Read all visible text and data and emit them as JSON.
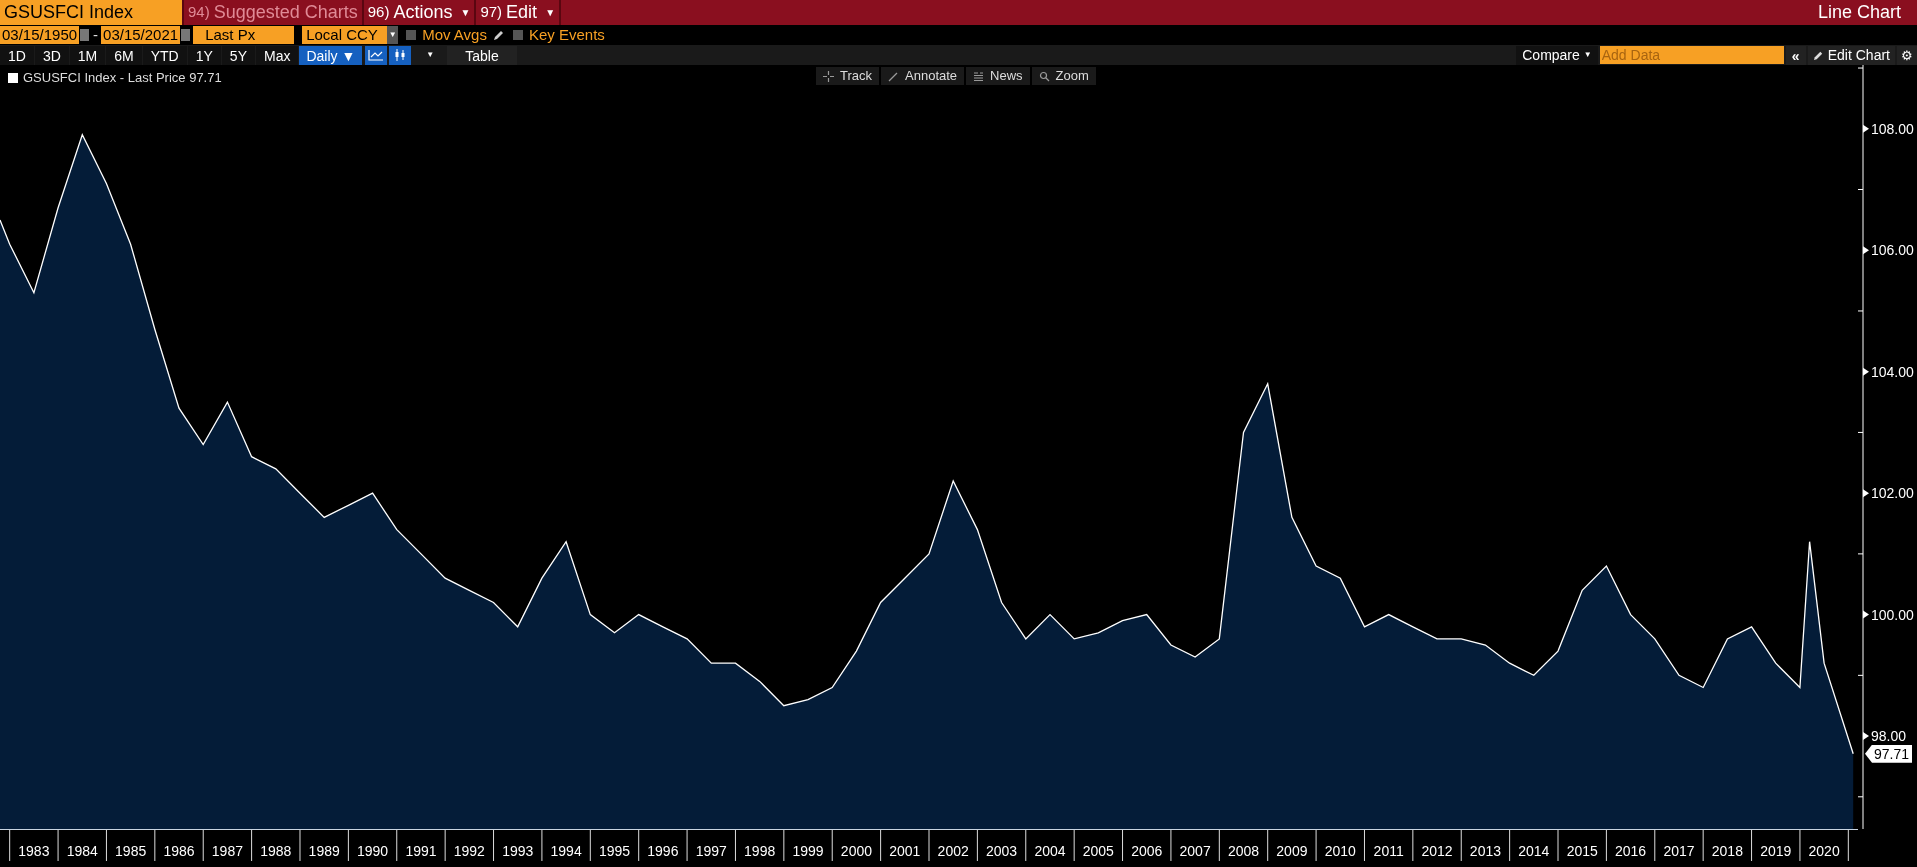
{
  "header": {
    "ticker": "GSUSFCI Index",
    "menus": [
      {
        "number": "94)",
        "label": "Suggested Charts",
        "disabled": true
      },
      {
        "number": "96)",
        "label": "Actions",
        "disabled": false,
        "caret": "▼"
      },
      {
        "number": "97)",
        "label": "Edit",
        "disabled": false,
        "caret": "▼"
      }
    ],
    "title": "Line Chart"
  },
  "settings": {
    "date_from": "03/15/1950",
    "separator": "-",
    "date_to": "03/15/2021",
    "field": "Last Px",
    "currency": "Local CCY",
    "currency_arrow": "▼",
    "checkboxes": [
      {
        "label": "Mov Avgs",
        "checked": false,
        "kind": "edit"
      },
      {
        "label": "Key Events",
        "checked": false,
        "kind": "plain"
      }
    ]
  },
  "toolbar": {
    "periods": [
      {
        "label": "1D",
        "selected": false
      },
      {
        "label": "3D",
        "selected": false
      },
      {
        "label": "1M",
        "selected": false
      },
      {
        "label": "6M",
        "selected": false
      },
      {
        "label": "YTD",
        "selected": false
      },
      {
        "label": "1Y",
        "selected": false
      },
      {
        "label": "5Y",
        "selected": false
      },
      {
        "label": "Max",
        "selected": false
      }
    ],
    "frequency": "Daily ▼",
    "chart_types": [
      {
        "kind": "line",
        "selected": true
      },
      {
        "kind": "candle",
        "selected": true
      }
    ],
    "chart_type_caret": "▼",
    "table_button": "Table",
    "compare": "Compare",
    "compare_caret": "▼",
    "collapse": "«",
    "settings": "⚙",
    "add_data_placeholder": "Add Data",
    "edit_chart": "Edit Chart"
  },
  "chart_tools": [
    {
      "kind": "track",
      "label": "Track"
    },
    {
      "kind": "annotate",
      "label": "Annotate"
    },
    {
      "kind": "news",
      "label": "News"
    },
    {
      "kind": "zoom",
      "label": "Zoom"
    }
  ],
  "legend_suffix": "- Last Price 97.71",
  "last_price_label": "97.71",
  "chart_data": {
    "type": "area",
    "x": [
      1982.3,
      1982.5,
      1983,
      1983.5,
      1984,
      1984.5,
      1985,
      1985.5,
      1986,
      1986.5,
      1987,
      1987.5,
      1988,
      1988.5,
      1989,
      1989.5,
      1990,
      1990.5,
      1991,
      1991.5,
      1992,
      1992.5,
      1993,
      1993.5,
      1994,
      1994.5,
      1995,
      1995.5,
      1996,
      1996.5,
      1997,
      1997.5,
      1998,
      1998.5,
      1999,
      1999.5,
      2000,
      2000.5,
      2001,
      2001.5,
      2002,
      2002.5,
      2003,
      2003.5,
      2004,
      2004.5,
      2005,
      2005.5,
      2006,
      2006.5,
      2007,
      2007.5,
      2008,
      2008.5,
      2009,
      2009.5,
      2010,
      2010.5,
      2011,
      2011.5,
      2012,
      2012.5,
      2013,
      2013.5,
      2014,
      2014.5,
      2015,
      2015.5,
      2016,
      2016.5,
      2017,
      2017.5,
      2018,
      2018.5,
      2019,
      2019.5,
      2019.7,
      2020,
      2020.6
    ],
    "series": [
      {
        "name": "GSUSFCI Index",
        "color": "#ffffff",
        "values": [
          106.5,
          106.1,
          105.3,
          106.7,
          107.9,
          107.1,
          106.1,
          104.7,
          103.4,
          102.8,
          103.5,
          102.6,
          102.4,
          102.0,
          101.6,
          101.8,
          102.0,
          101.4,
          101.0,
          100.6,
          100.4,
          100.2,
          99.8,
          100.6,
          101.2,
          100.0,
          99.7,
          100.0,
          99.8,
          99.6,
          99.2,
          99.2,
          98.9,
          98.5,
          98.6,
          98.8,
          99.4,
          100.2,
          100.6,
          101.0,
          102.2,
          101.4,
          100.2,
          99.6,
          100.0,
          99.6,
          99.7,
          99.9,
          100.0,
          99.5,
          99.3,
          99.6,
          103.0,
          103.8,
          101.6,
          100.8,
          100.6,
          99.8,
          100.0,
          99.8,
          99.6,
          99.6,
          99.5,
          99.2,
          99.0,
          99.4,
          100.4,
          100.8,
          100.0,
          99.6,
          99.0,
          98.8,
          99.6,
          99.8,
          99.2,
          98.8,
          101.2,
          99.2,
          97.71
        ]
      }
    ],
    "xlim": [
      1982.3,
      2020.7
    ],
    "ylim": [
      96.47,
      109.05
    ],
    "xticks": [
      1983,
      1984,
      1985,
      1986,
      1987,
      1988,
      1989,
      1990,
      1991,
      1992,
      1993,
      1994,
      1995,
      1996,
      1997,
      1998,
      1999,
      2000,
      2001,
      2002,
      2003,
      2004,
      2005,
      2006,
      2007,
      2008,
      2009,
      2010,
      2011,
      2012,
      2013,
      2014,
      2015,
      2016,
      2017,
      2018,
      2019,
      2020
    ],
    "yticks": [
      {
        "value": 98,
        "label": "98.00"
      },
      {
        "value": 100,
        "label": "100.00"
      },
      {
        "value": 102,
        "label": "102.00"
      },
      {
        "value": 104,
        "label": "104.00"
      },
      {
        "value": 106,
        "label": "106.00"
      },
      {
        "value": 108,
        "label": "108.00"
      }
    ]
  }
}
